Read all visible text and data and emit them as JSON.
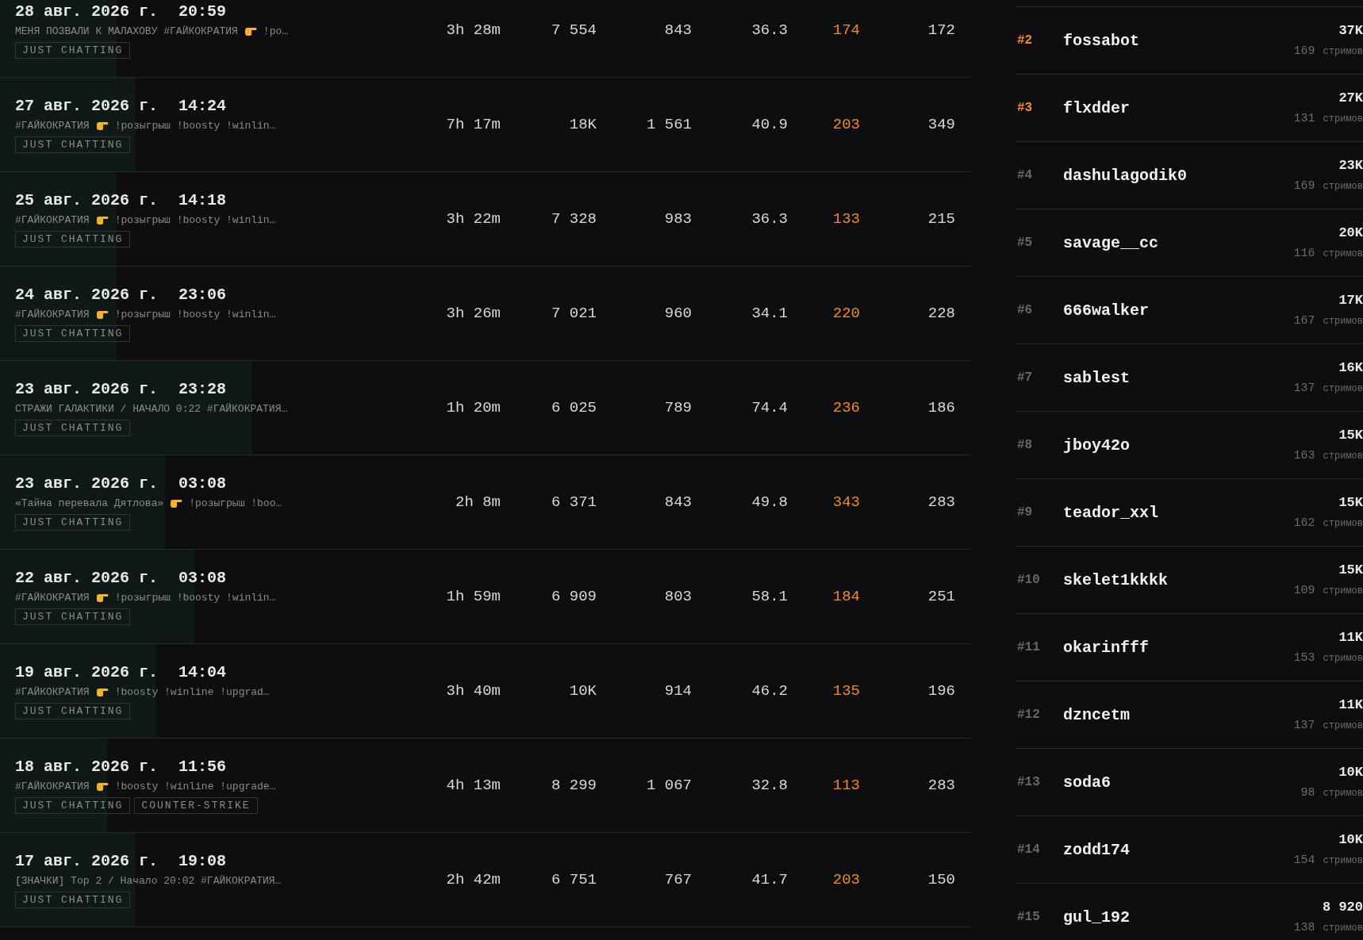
{
  "stat_columns": [
    {
      "accent": false
    },
    {
      "accent": false
    },
    {
      "accent": false
    },
    {
      "accent": false
    },
    {
      "accent": true
    },
    {
      "accent": false
    }
  ],
  "streams": [
    {
      "date": "28 авг. 2026 г.",
      "time": "20:59",
      "title_segments": [
        "МЕНЯ ПОЗВАЛИ К МАЛАХОВУ #ГАЙКОКРАТИЯ",
        "!ро…"
      ],
      "tags": [
        "JUST CHATTING"
      ],
      "stats": [
        "3h 28m",
        "7 554",
        "843",
        "36.3",
        "174",
        "172"
      ],
      "level": 0.12
    },
    {
      "date": "27 авг. 2026 г.",
      "time": "14:24",
      "title_segments": [
        "#ГАЙКОКРАТИЯ",
        "!розыгрыш !boosty !winlin…"
      ],
      "tags": [
        "JUST CHATTING"
      ],
      "stats": [
        "7h 17m",
        "18K",
        "1 561",
        "40.9",
        "203",
        "349"
      ],
      "level": 0.14
    },
    {
      "date": "25 авг. 2026 г.",
      "time": "14:18",
      "title_segments": [
        "#ГАЙКОКРАТИЯ",
        "!розыгрыш !boosty !winlin…"
      ],
      "tags": [
        "JUST CHATTING"
      ],
      "stats": [
        "3h 22m",
        "7 328",
        "983",
        "36.3",
        "133",
        "215"
      ],
      "level": 0.12
    },
    {
      "date": "24 авг. 2026 г.",
      "time": "23:06",
      "title_segments": [
        "#ГАЙКОКРАТИЯ",
        "!розыгрыш !boosty !winlin…"
      ],
      "tags": [
        "JUST CHATTING"
      ],
      "stats": [
        "3h 26m",
        "7 021",
        "960",
        "34.1",
        "220",
        "228"
      ],
      "level": 0.12
    },
    {
      "date": "23 авг. 2026 г.",
      "time": "23:28",
      "title_segments": [
        "СТРАЖИ ГАЛАКТИКИ / НАЧАЛО 0:22 #ГАЙКОКРАТИЯ…"
      ],
      "tags": [
        "JUST CHATTING"
      ],
      "stats": [
        "1h 20m",
        "6 025",
        "789",
        "74.4",
        "236",
        "186"
      ],
      "level": 0.26
    },
    {
      "date": "23 авг. 2026 г.",
      "time": "03:08",
      "title_segments": [
        "«Тайна перевала Дятлова»",
        "!розыгрыш !boo…"
      ],
      "tags": [
        "JUST CHATTING"
      ],
      "stats": [
        "2h 8m",
        "6 371",
        "843",
        "49.8",
        "343",
        "283"
      ],
      "level": 0.17
    },
    {
      "date": "22 авг. 2026 г.",
      "time": "03:08",
      "title_segments": [
        "#ГАЙКОКРАТИЯ",
        "!розыгрыш !boosty !winlin…"
      ],
      "tags": [
        "JUST CHATTING"
      ],
      "stats": [
        "1h 59m",
        "6 909",
        "803",
        "58.1",
        "184",
        "251"
      ],
      "level": 0.2
    },
    {
      "date": "19 авг. 2026 г.",
      "time": "14:04",
      "title_segments": [
        "#ГАЙКОКРАТИЯ",
        "!boosty !winline !upgrad…"
      ],
      "tags": [
        "JUST CHATTING"
      ],
      "stats": [
        "3h 40m",
        "10K",
        "914",
        "46.2",
        "135",
        "196"
      ],
      "level": 0.16
    },
    {
      "date": "18 авг. 2026 г.",
      "time": "11:56",
      "title_segments": [
        "#ГАЙКОКРАТИЯ",
        "!boosty !winline !upgrade…"
      ],
      "tags": [
        "JUST CHATTING",
        "COUNTER-STRIKE"
      ],
      "stats": [
        "4h 13m",
        "8 299",
        "1 067",
        "32.8",
        "113",
        "283"
      ],
      "level": 0.11
    },
    {
      "date": "17 авг. 2026 г.",
      "time": "19:08",
      "title_segments": [
        "[ЗНАЧКИ] Top 2 / Начало 20:02 #ГАЙКОКРАТИЯ…"
      ],
      "tags": [
        "JUST CHATTING"
      ],
      "stats": [
        "2h 42m",
        "6 751",
        "767",
        "41.7",
        "203",
        "150"
      ],
      "level": 0.14
    }
  ],
  "leaderboard": [
    {
      "rank": "#2",
      "top": true,
      "name": "fossabot",
      "value": "37K",
      "count": "169",
      "unit": "стримов"
    },
    {
      "rank": "#3",
      "top": true,
      "name": "flxdder",
      "value": "27K",
      "count": "131",
      "unit": "стримов"
    },
    {
      "rank": "#4",
      "top": false,
      "name": "dashulagodik0",
      "value": "23K",
      "count": "169",
      "unit": "стримов"
    },
    {
      "rank": "#5",
      "top": false,
      "name": "savage__cc",
      "value": "20K",
      "count": "116",
      "unit": "стримов"
    },
    {
      "rank": "#6",
      "top": false,
      "name": "666walker",
      "value": "17K",
      "count": "167",
      "unit": "стримов"
    },
    {
      "rank": "#7",
      "top": false,
      "name": "sablest",
      "value": "16K",
      "count": "137",
      "unit": "стримов"
    },
    {
      "rank": "#8",
      "top": false,
      "name": "jboy42o",
      "value": "15K",
      "count": "163",
      "unit": "стримов"
    },
    {
      "rank": "#9",
      "top": false,
      "name": "teador_xxl",
      "value": "15K",
      "count": "162",
      "unit": "стримов"
    },
    {
      "rank": "#10",
      "top": false,
      "name": "skelet1kkkk",
      "value": "15K",
      "count": "109",
      "unit": "стримов"
    },
    {
      "rank": "#11",
      "top": false,
      "name": "okarinfff",
      "value": "11K",
      "count": "153",
      "unit": "стримов"
    },
    {
      "rank": "#12",
      "top": false,
      "name": "dzncetm",
      "value": "11K",
      "count": "137",
      "unit": "стримов"
    },
    {
      "rank": "#13",
      "top": false,
      "name": "soda6",
      "value": "10K",
      "count": "98",
      "unit": "стримов"
    },
    {
      "rank": "#14",
      "top": false,
      "name": "zodd174",
      "value": "10K",
      "count": "154",
      "unit": "стримов"
    },
    {
      "rank": "#15",
      "top": false,
      "name": "gul_192",
      "value": "8 920",
      "count": "138",
      "unit": "стримов"
    }
  ]
}
